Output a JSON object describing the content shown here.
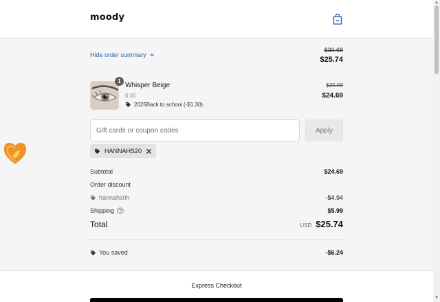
{
  "header": {
    "logo": "moody"
  },
  "summary": {
    "toggle_label": "Hide order summary",
    "original_total": "$30.68",
    "total": "$25.74"
  },
  "product": {
    "quantity": "1",
    "name": "Whisper Beige",
    "subtitle": "0.00",
    "discount_label": "2025Back to school (-$1.30)",
    "original_price": "$25.99",
    "price": "$24.69"
  },
  "coupon": {
    "placeholder": "Gift cards or coupon codes",
    "value": "",
    "apply_label": "Apply",
    "applied_code": "HANNAHS20"
  },
  "totals": {
    "subtotal_label": "Subtotal",
    "subtotal_value": "$24.69",
    "order_discount_label": "Order discount",
    "discount_code": "hannahs0h",
    "discount_value": "-$4.94",
    "shipping_label": "Shipping",
    "shipping_value": "$5.99",
    "total_label": "Total",
    "currency": "USD",
    "total_value": "$25.74",
    "saved_label": "You saved",
    "saved_value": "-$6.24"
  },
  "express_checkout": {
    "label": "Express Checkout"
  },
  "colors": {
    "link": "#1d5fa8",
    "panel_bg": "#f5f5f5",
    "chip_bg": "#e3e3e3"
  },
  "icons": [
    "shopping-bag-icon",
    "chevron-up-icon",
    "tag-icon",
    "close-icon",
    "help-circle-icon",
    "heart-widget-icon"
  ]
}
